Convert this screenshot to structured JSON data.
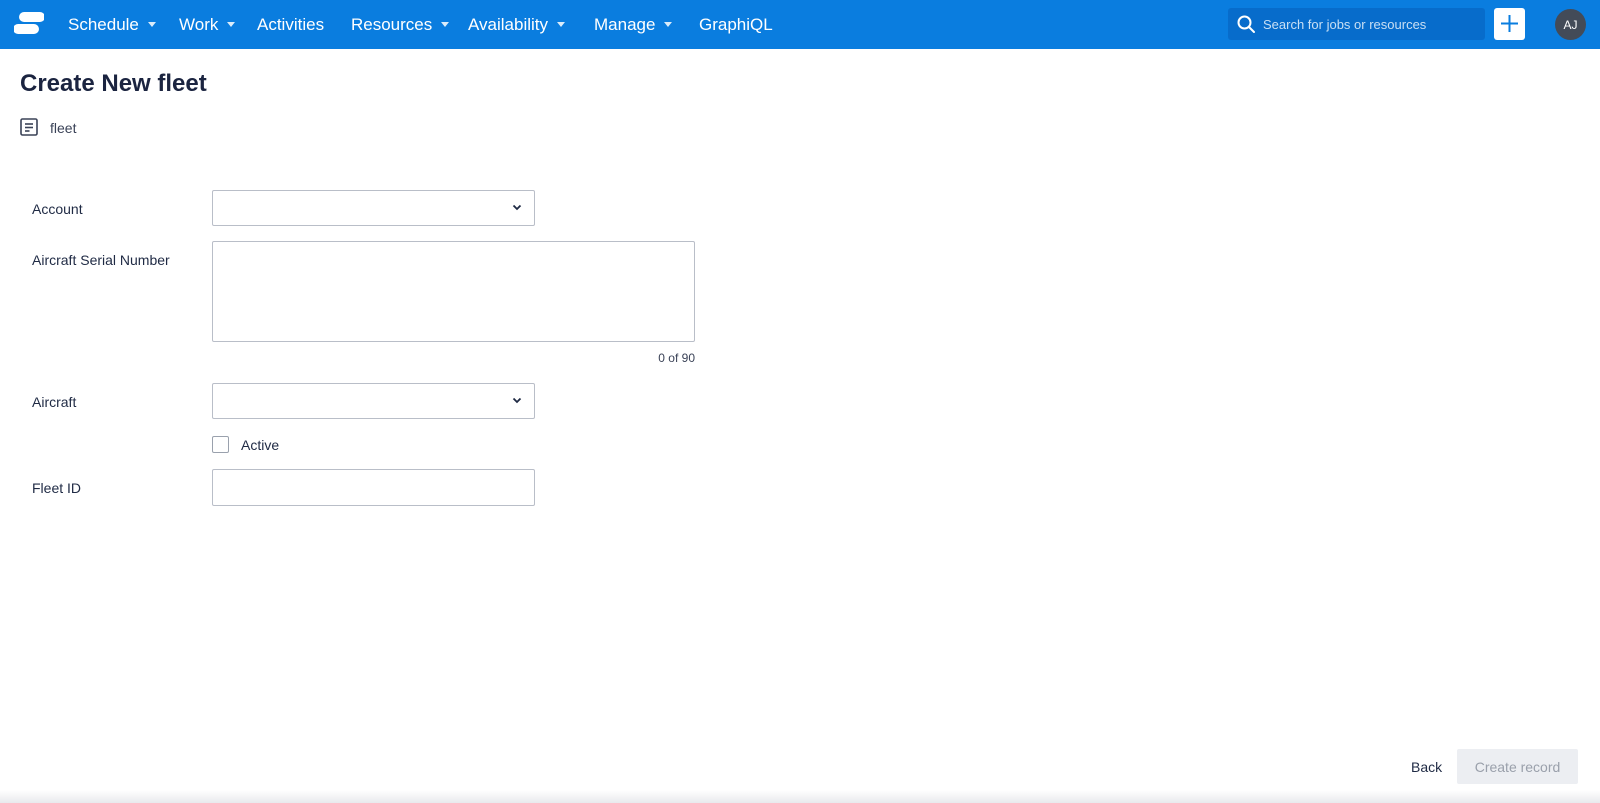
{
  "nav": {
    "items": [
      {
        "label": "Schedule",
        "has_caret": true
      },
      {
        "label": "Work",
        "has_caret": true
      },
      {
        "label": "Activities",
        "has_caret": false
      },
      {
        "label": "Resources",
        "has_caret": true
      },
      {
        "label": "Availability",
        "has_caret": true
      },
      {
        "label": "Manage",
        "has_caret": true
      },
      {
        "label": "GraphiQL",
        "has_caret": false
      }
    ],
    "search_placeholder": "Search for jobs or resources",
    "avatar_initials": "AJ"
  },
  "header": {
    "title": "Create New fleet",
    "object_name": "fleet"
  },
  "form": {
    "account_label": "Account",
    "account_value": "",
    "serial_label": "Aircraft Serial Number",
    "serial_value": "",
    "serial_counter": "0 of 90",
    "aircraft_label": "Aircraft",
    "aircraft_value": "",
    "active_label": "Active",
    "active_checked": false,
    "fleet_id_label": "Fleet ID",
    "fleet_id_value": ""
  },
  "footer": {
    "back_label": "Back",
    "create_label": "Create record"
  },
  "colors": {
    "nav_background": "#0a7ddf",
    "avatar_background": "#434b58",
    "disabled_button": "#eceef2"
  }
}
